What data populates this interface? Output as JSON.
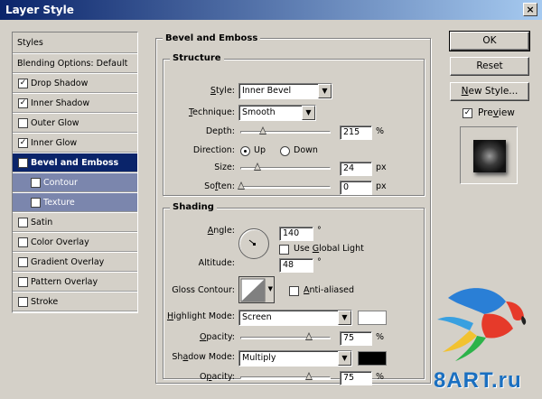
{
  "window": {
    "title": "Layer Style",
    "close_glyph": "×"
  },
  "sidebar": {
    "styles_header": "Styles",
    "blending_options": "Blending Options: Default",
    "items": [
      {
        "label": "Drop Shadow",
        "checked": true
      },
      {
        "label": "Inner Shadow",
        "checked": true
      },
      {
        "label": "Outer Glow",
        "checked": false
      },
      {
        "label": "Inner Glow",
        "checked": true
      },
      {
        "label": "Bevel and Emboss",
        "checked": true
      },
      {
        "label": "Contour",
        "checked": true
      },
      {
        "label": "Texture",
        "checked": true
      },
      {
        "label": "Satin",
        "checked": false
      },
      {
        "label": "Color Overlay",
        "checked": false
      },
      {
        "label": "Gradient Overlay",
        "checked": false
      },
      {
        "label": "Pattern Overlay",
        "checked": false
      },
      {
        "label": "Stroke",
        "checked": false
      }
    ],
    "check_glyph": "✓"
  },
  "bevel": {
    "section_title": "Bevel and Emboss",
    "structure_title": "Structure",
    "style_label": "Style:",
    "style_value": "Inner Bevel",
    "technique_label": "Technique:",
    "technique_value": "Smooth",
    "depth_label": "Depth:",
    "depth_value": "215",
    "depth_unit": "%",
    "direction_label": "Direction:",
    "direction_up": "Up",
    "direction_down": "Down",
    "size_label": "Size:",
    "size_value": "24",
    "size_unit": "px",
    "soften_label": "Soften:",
    "soften_value": "0",
    "soften_unit": "px"
  },
  "shading": {
    "title": "Shading",
    "angle_label": "Angle:",
    "angle_value": "140",
    "degree": "°",
    "use_global_light": "Use Global Light",
    "altitude_label": "Altitude:",
    "altitude_value": "48",
    "gloss_contour_label": "Gloss Contour:",
    "anti_aliased": "Anti-aliased",
    "highlight_mode_label": "Highlight Mode:",
    "highlight_mode_value": "Screen",
    "highlight_color": "#ffffff",
    "opacity_label": "Opacity:",
    "highlight_opacity": "75",
    "percent": "%",
    "shadow_mode_label": "Shadow Mode:",
    "shadow_mode_value": "Multiply",
    "shadow_color": "#000000",
    "shadow_opacity_label": "Opacity:",
    "shadow_opacity": "75"
  },
  "buttons": {
    "ok": "OK",
    "reset": "Reset",
    "new_style": "New Style...",
    "preview": "Preview"
  },
  "watermark": {
    "text": "8ART.ru"
  }
}
